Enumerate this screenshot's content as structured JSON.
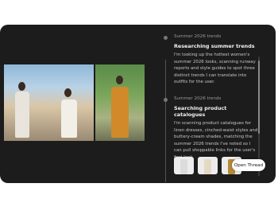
{
  "thread": {
    "items": [
      {
        "label": "Summer 2026 trends",
        "title": "Researching summer trends",
        "text": "I'm looking up the hottest women's summer 2026 looks, scanning runway reports and style guides to spot three distinct trends I can translate into outfits for the user."
      },
      {
        "label": "Summer 2026 trends",
        "title": "Searching product catalogues",
        "text": "I'm scanning product catalogues for linen dresses, cinched-waist styles and buttery-cream shades, matching the summer 2026 trends I've noted so I can pull shoppable links for the user's first look."
      }
    ],
    "open_thread_label": "Open Thread"
  }
}
